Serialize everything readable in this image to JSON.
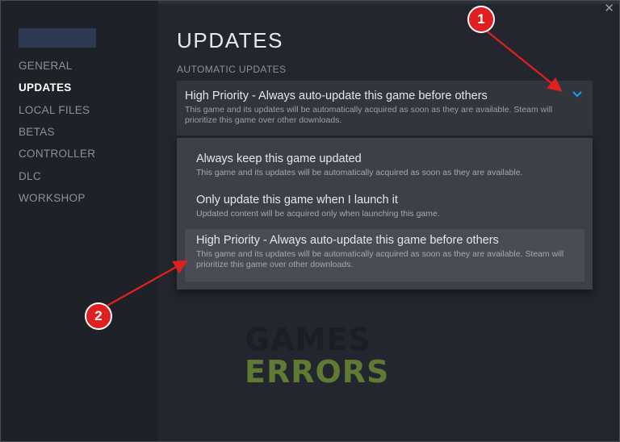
{
  "window": {
    "close_glyph": "✕"
  },
  "sidebar": {
    "items": [
      {
        "label": "GENERAL",
        "active": false
      },
      {
        "label": "UPDATES",
        "active": true
      },
      {
        "label": "LOCAL FILES",
        "active": false
      },
      {
        "label": "BETAS",
        "active": false
      },
      {
        "label": "CONTROLLER",
        "active": false
      },
      {
        "label": "DLC",
        "active": false
      },
      {
        "label": "WORKSHOP",
        "active": false
      }
    ]
  },
  "main": {
    "title": "UPDATES",
    "section_label": "AUTOMATIC UPDATES",
    "dropdown": {
      "selected_title": "High Priority - Always auto-update this game before others",
      "selected_desc": "This game and its updates will be automatically acquired as soon as they are available. Steam will prioritize this game over other downloads.",
      "icon": "chevron-down-icon",
      "accent_color": "#1a9fff"
    },
    "options": [
      {
        "title": "Always keep this game updated",
        "desc": "This game and its updates will be automatically acquired as soon as they are available."
      },
      {
        "title": "Only update this game when I launch it",
        "desc": "Updated content will be acquired only when launching this game."
      },
      {
        "title": "High Priority - Always auto-update this game before others",
        "desc": "This game and its updates will be automatically acquired as soon as they are available. Steam will prioritize this game over other downloads.",
        "highlighted": true
      }
    ]
  },
  "annotations": {
    "badge_1": "1",
    "badge_2": "2",
    "color": "#e02020"
  },
  "watermark": {
    "line1": "GAMES",
    "line2": "ERRORS"
  }
}
